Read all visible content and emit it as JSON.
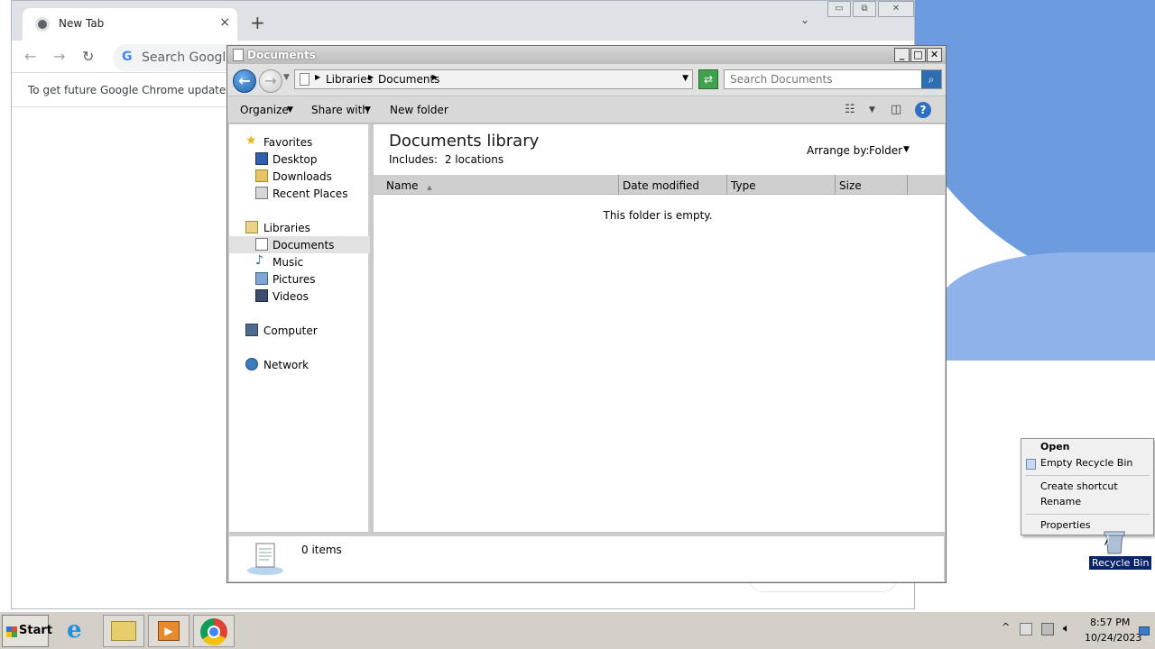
{
  "chrome": {
    "tab_title": "New Tab",
    "tab_close": "×",
    "new_tab": "+",
    "omnibox_placeholder": "Search Google",
    "omnibox_g": "G",
    "infobar_text": "To get future Google Chrome updates, yo"
  },
  "explorer": {
    "title": "Documents",
    "breadcrumb": [
      "Libraries",
      "Documents"
    ],
    "search_placeholder": "Search Documents",
    "toolbar": {
      "organize": "Organize",
      "share_with": "Share with",
      "new_folder": "New folder"
    },
    "nav": {
      "favorites": "Favorites",
      "desktop": "Desktop",
      "downloads": "Downloads",
      "recent_places": "Recent Places",
      "libraries": "Libraries",
      "documents": "Documents",
      "music": "Music",
      "pictures": "Pictures",
      "videos": "Videos",
      "computer": "Computer",
      "network": "Network"
    },
    "library_title": "Documents library",
    "includes_label": "Includes:",
    "includes_link": "2 locations",
    "arrange_by_label": "Arrange by:",
    "arrange_by_value": "Folder",
    "columns": [
      "Name",
      "Date modified",
      "Type",
      "Size"
    ],
    "empty_message": "This folder is empty.",
    "item_count": "0 items"
  },
  "context_menu": {
    "items": [
      "Open",
      "Empty Recycle Bin",
      "Create shortcut",
      "Rename",
      "Properties"
    ]
  },
  "desktop": {
    "recycle_bin_label": "Recycle Bin"
  },
  "taskbar": {
    "start_label": "Start",
    "time": "8:57 PM",
    "date": "10/24/2023"
  },
  "colors": {
    "wallpaper_blue": "#6d9be0",
    "explorer_chrome": "#c9c9c9",
    "selection": "#0a246a"
  }
}
